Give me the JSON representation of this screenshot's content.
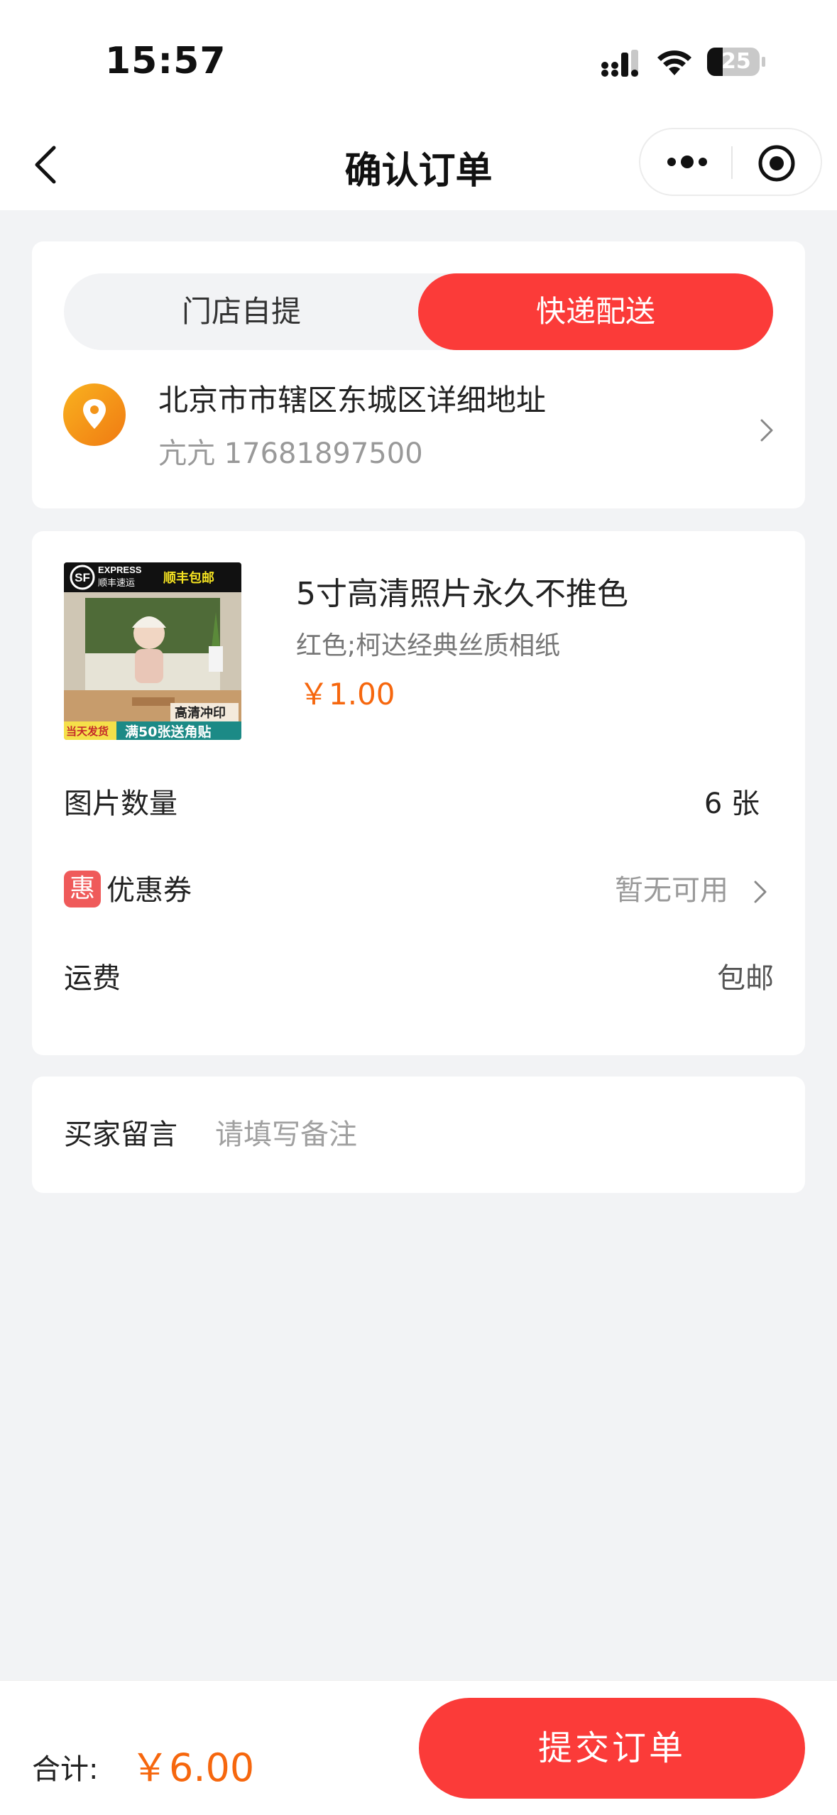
{
  "status_bar": {
    "time": "15:57",
    "battery": "25"
  },
  "nav": {
    "title": "确认订单"
  },
  "delivery_tabs": [
    {
      "label": "门店自提",
      "selected": false
    },
    {
      "label": "快递配送",
      "selected": true
    }
  ],
  "address": {
    "line": "北京市市辖区东城区详细地址",
    "contact": "亢亢 17681897500"
  },
  "product": {
    "title": "5寸高清照片永久不推色",
    "spec": "红色;柯达经典丝质相纸",
    "price": "￥1.00",
    "thumb": {
      "badge_brand": "EXPRESS",
      "badge_brand_cn": "顺丰速运",
      "badge_tag": "顺丰包邮",
      "label_print": "高清冲印",
      "label_ship": "当天发货",
      "label_promo": "满50张送角贴"
    }
  },
  "rows": {
    "quantity": {
      "label": "图片数量",
      "value": "6 张"
    },
    "coupon": {
      "badge": "惠",
      "label": "优惠券",
      "value": "暂无可用"
    },
    "shipping": {
      "label": "运费",
      "value": "包邮"
    }
  },
  "message": {
    "label": "买家留言",
    "placeholder": "请填写备注"
  },
  "footer": {
    "total_label": "合计:",
    "total_value": "￥6.00",
    "submit_label": "提交订单"
  },
  "colors": {
    "accent_red": "#fb3b39",
    "price_orange": "#f6670e",
    "location_orange": "#f5a01c"
  }
}
